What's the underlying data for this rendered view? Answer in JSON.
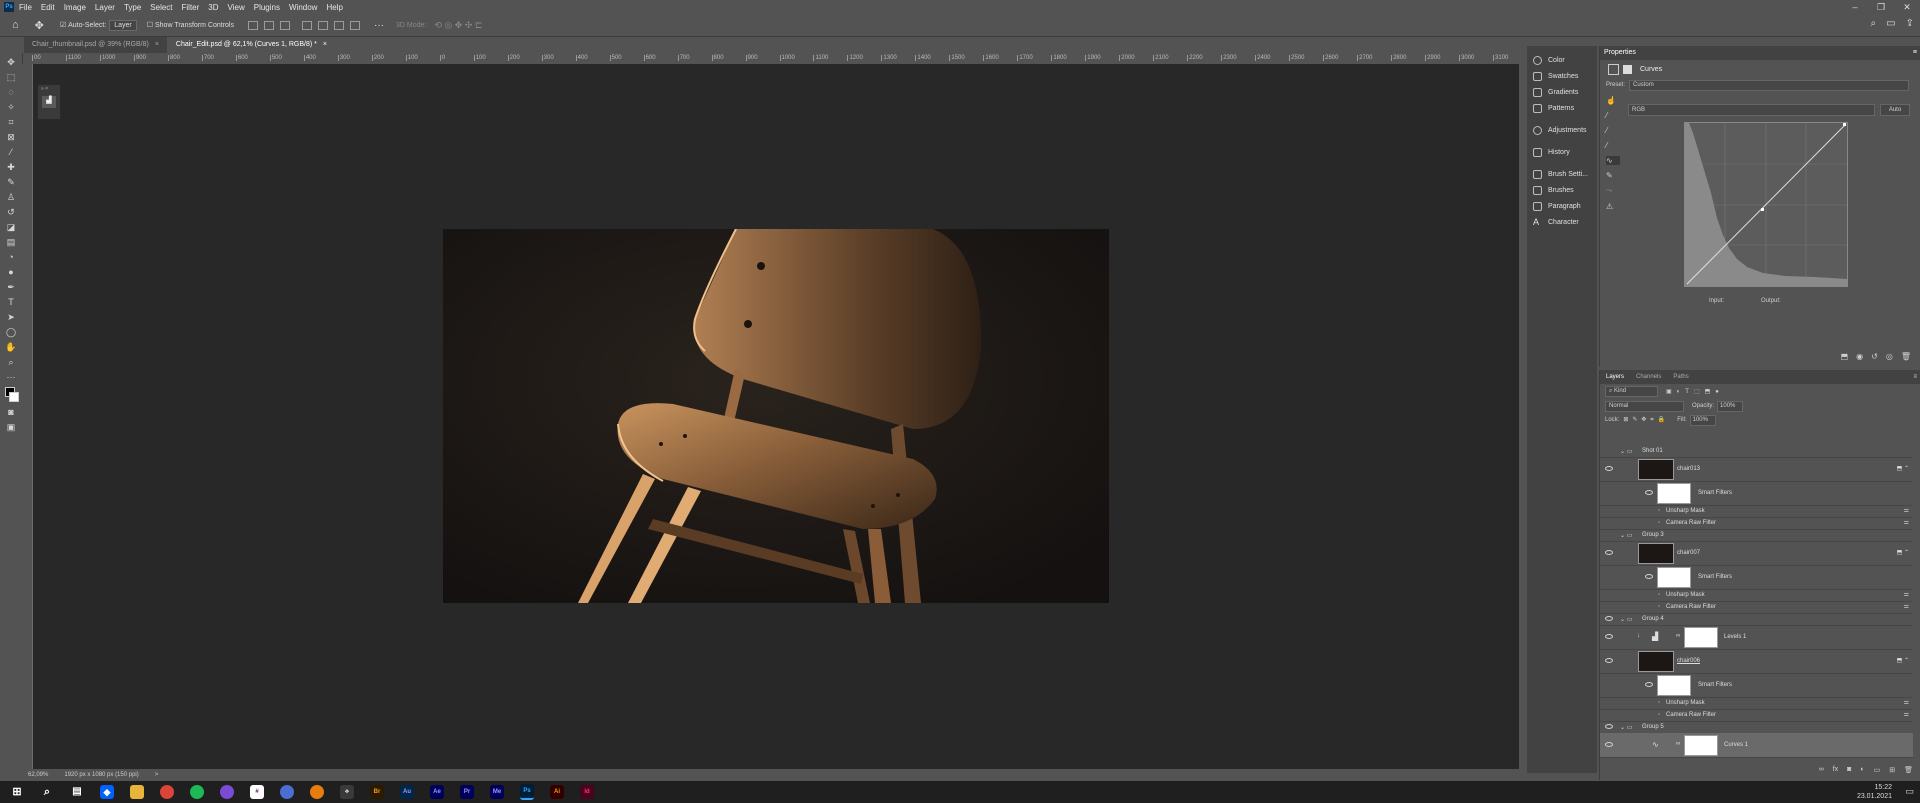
{
  "menu": {
    "items": [
      "File",
      "Edit",
      "Image",
      "Layer",
      "Type",
      "Select",
      "Filter",
      "3D",
      "View",
      "Plugins",
      "Window",
      "Help"
    ]
  },
  "options": {
    "auto_select": "Auto-Select:",
    "layer_value": "Layer",
    "transform": "Show Transform Controls",
    "mode3d": "3D Mode:"
  },
  "tabs": [
    {
      "label": "Chair_thumbnail.psd @ 39% (RGB/8)"
    },
    {
      "label": "Chair_Edit.psd @ 62,1% (Curves 1, RGB/8) *"
    }
  ],
  "ruler": {
    "ticks": [
      "00",
      "1100",
      "1000",
      "900",
      "800",
      "700",
      "600",
      "500",
      "400",
      "300",
      "200",
      "100",
      "0",
      "100",
      "200",
      "300",
      "400",
      "500",
      "600",
      "700",
      "800",
      "900",
      "1000",
      "1100",
      "1200",
      "1300",
      "1400",
      "1500",
      "1600",
      "1700",
      "1800",
      "1900",
      "2000",
      "2100",
      "2200",
      "2300",
      "2400",
      "2500",
      "2600",
      "2700",
      "2800",
      "2900",
      "3000",
      "3100"
    ]
  },
  "status": {
    "zoom": "62,09%",
    "size": "1920 px x 1080 px (150 ppi)",
    "arrow": ">"
  },
  "dock": {
    "groups": [
      [
        "Color",
        "Swatches",
        "Gradients",
        "Patterns"
      ],
      [
        "Adjustments"
      ],
      [
        "History"
      ],
      [
        "Brush Setti...",
        "Brushes",
        "Paragraph",
        "Character"
      ]
    ]
  },
  "properties": {
    "title": "Properties",
    "adjust": "Curves",
    "preset_label": "Preset:",
    "preset": "Custom",
    "channel": "RGB",
    "auto": "Auto",
    "input": "Input:",
    "output": "Output:"
  },
  "layers": {
    "tabs": [
      "Layers",
      "Channels",
      "Paths"
    ],
    "kind": "Kind",
    "blend": "Normal",
    "opacity_label": "Opacity:",
    "opacity": "100%",
    "lock_label": "Lock:",
    "fill_label": "Fill:",
    "fill": "100%",
    "rows": {
      "g1": "Shot 01",
      "l1": "chair013",
      "sf1": "Smart Filters",
      "um1": "Unsharp Mask",
      "cr1": "Camera Raw Filter",
      "g3": "Group 3",
      "l2": "chair007",
      "sf2": "Smart Filters",
      "um2": "Unsharp Mask",
      "cr2": "Camera Raw Filter",
      "g4": "Group 4",
      "lv": "Levels 1",
      "l3": "chair006",
      "sf3": "Smart Filters",
      "um3": "Unsharp Mask",
      "cr3": "Camera Raw Filter",
      "g5": "Group 5",
      "cv": "Curves 1"
    },
    "fx": "fx"
  },
  "taskbar": {
    "apps": [
      {
        "label": "Br",
        "color": "#2b1a00",
        "fg": "#e8a02b"
      },
      {
        "label": "Au",
        "color": "#00264a",
        "fg": "#9999ff"
      },
      {
        "label": "Ae",
        "color": "#00005b",
        "fg": "#9999ff"
      },
      {
        "label": "Pr",
        "color": "#00005b",
        "fg": "#9999ff"
      },
      {
        "label": "Me",
        "color": "#00005b",
        "fg": "#9999ff"
      },
      {
        "label": "Ps",
        "color": "#001e36",
        "fg": "#31a8ff"
      },
      {
        "label": "Ai",
        "color": "#330000",
        "fg": "#ff9a00"
      },
      {
        "label": "Id",
        "color": "#49021f",
        "fg": "#ff3366"
      }
    ],
    "time": "15:22",
    "date": "23.01.2021"
  }
}
